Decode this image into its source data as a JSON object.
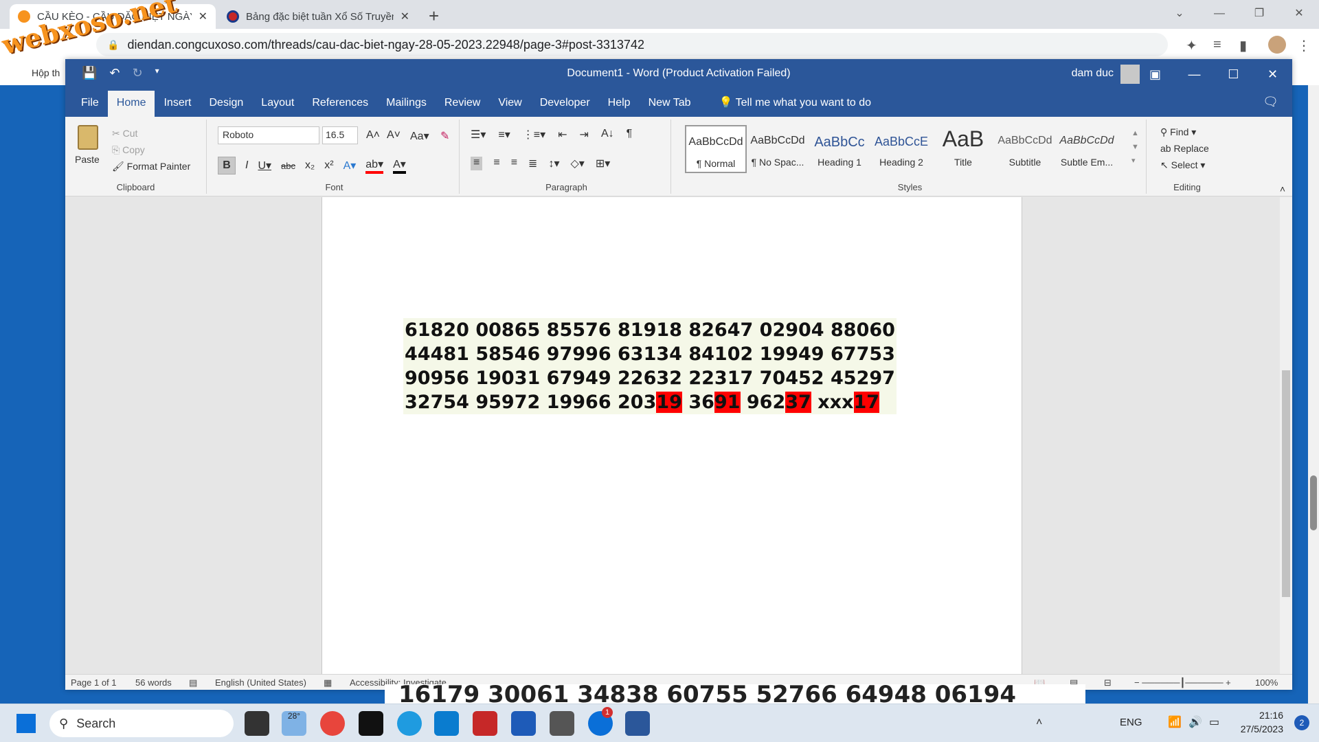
{
  "browser": {
    "tabs": [
      {
        "title": "CẦU KÈO - CẦU ĐẶC BIỆT NGÀY",
        "close": "✕"
      },
      {
        "title": "Bảng đặc biệt tuần Xổ Số Truyền",
        "close": "✕"
      }
    ],
    "new_tab": "+",
    "url": "diendan.congcuxoso.com/threads/cau-dac-biet-ngay-28-05-2023.22948/page-3#post-3313742",
    "bookmark": "Hộp th",
    "watermark": "webxoso.net"
  },
  "word": {
    "title": "Document1  -  Word (Product Activation Failed)",
    "user": "dam duc",
    "menu": [
      "File",
      "Home",
      "Insert",
      "Design",
      "Layout",
      "References",
      "Mailings",
      "Review",
      "View",
      "Developer",
      "Help",
      "New Tab"
    ],
    "tell": "Tell me what you want to do",
    "clipboard": {
      "paste": "Paste",
      "cut": "Cut",
      "copy": "Copy",
      "format_painter": "Format Painter",
      "label": "Clipboard"
    },
    "font": {
      "name": "Roboto",
      "size": "16.5",
      "label": "Font"
    },
    "paragraph_label": "Paragraph",
    "styles": {
      "label": "Styles",
      "items": [
        {
          "preview": "AaBbCcDd",
          "name": "¶ Normal"
        },
        {
          "preview": "AaBbCcDd",
          "name": "¶ No Spac..."
        },
        {
          "preview": "AaBbCc",
          "name": "Heading 1"
        },
        {
          "preview": "AaBbCcE",
          "name": "Heading 2"
        },
        {
          "preview": "AaB",
          "name": "Title"
        },
        {
          "preview": "AaBbCcDd",
          "name": "Subtitle"
        },
        {
          "preview": "AaBbCcDd",
          "name": "Subtle Em..."
        }
      ]
    },
    "editing": {
      "find": "Find",
      "replace": "Replace",
      "select": "Select",
      "label": "Editing"
    },
    "document": {
      "rows": [
        "61820 00865 85576 81918 82647 02904 88060",
        "44481 58546 97996 63134 84102 19949 67753",
        "90956 19031 67949 22632 22317 70452 45297"
      ],
      "last_row": [
        {
          "t": "32754 95972 19966 203",
          "hl": false
        },
        {
          "t": "19",
          "hl": true
        },
        {
          "t": " 36",
          "hl": false
        },
        {
          "t": "91",
          "hl": true
        },
        {
          "t": " 962",
          "hl": false
        },
        {
          "t": "37",
          "hl": true
        },
        {
          "t": " xxx",
          "hl": false
        },
        {
          "t": "17",
          "hl": true
        }
      ],
      "highlight_color": "#ff0000"
    },
    "status": {
      "page": "Page 1 of 1",
      "words": "56 words",
      "language": "English (United States)",
      "accessibility": "Accessibility: Investigate",
      "zoom": "100%"
    }
  },
  "background_numbers": "16179 30061 34838 60755 52766 64948 06194",
  "taskbar": {
    "search": "Search",
    "weather": "28°",
    "lang": "ENG",
    "time": "21:16",
    "date": "27/5/2023",
    "notifications": "2",
    "zalo_badge": "1"
  }
}
